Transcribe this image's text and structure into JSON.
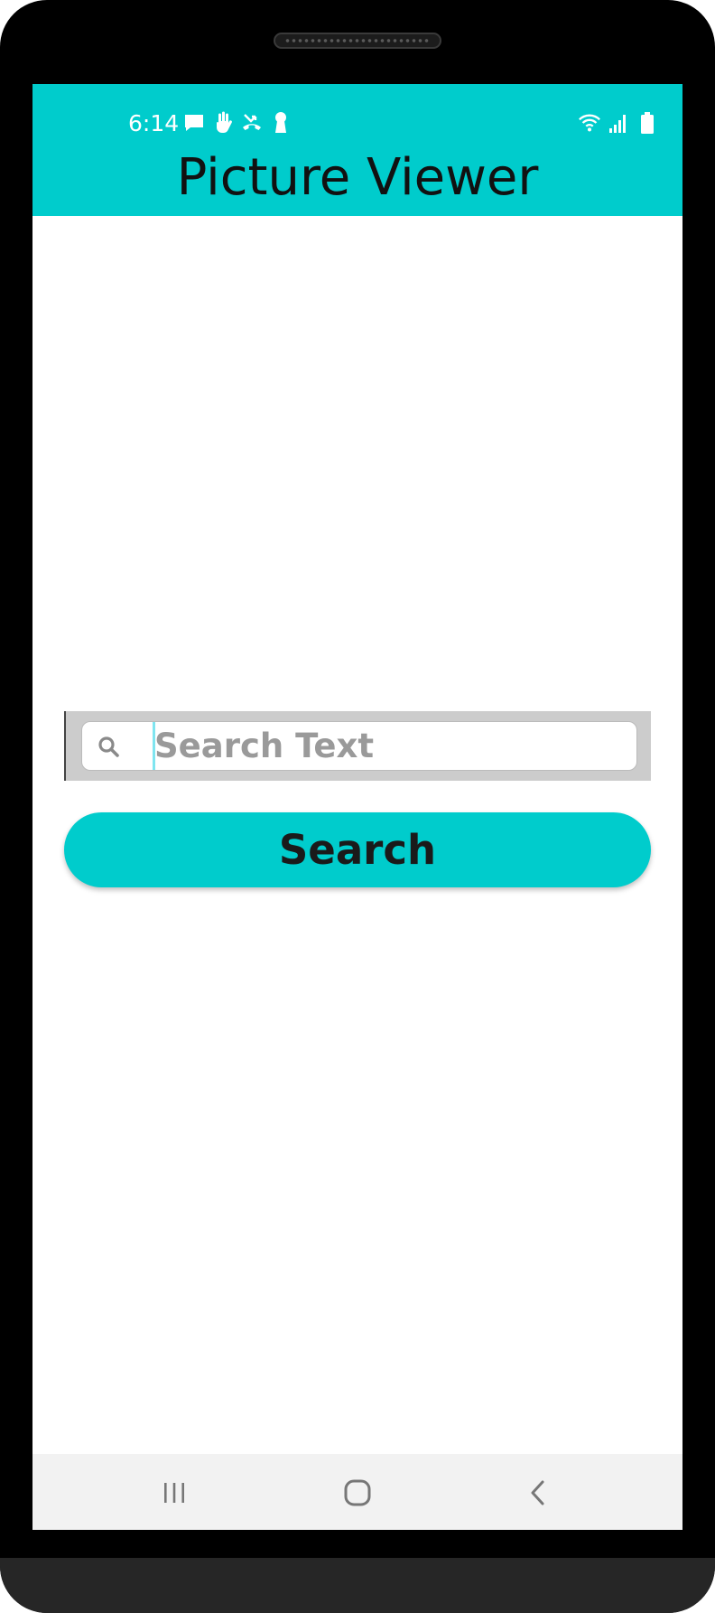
{
  "status_bar": {
    "time": "6:14",
    "left_icons": [
      "message-icon",
      "hand-icon",
      "missed-call-icon",
      "keyhole-icon"
    ],
    "right_icons": [
      "wifi-icon",
      "signal-icon",
      "battery-icon"
    ]
  },
  "app_bar": {
    "title": "Picture Viewer",
    "background": "#00cccc"
  },
  "search": {
    "placeholder": "Search Text",
    "value": "",
    "icon": "search-icon"
  },
  "search_button": {
    "label": "Search",
    "background": "#00cccc"
  },
  "nav_bar": {
    "buttons": [
      "recents-icon",
      "home-icon",
      "back-icon"
    ]
  }
}
